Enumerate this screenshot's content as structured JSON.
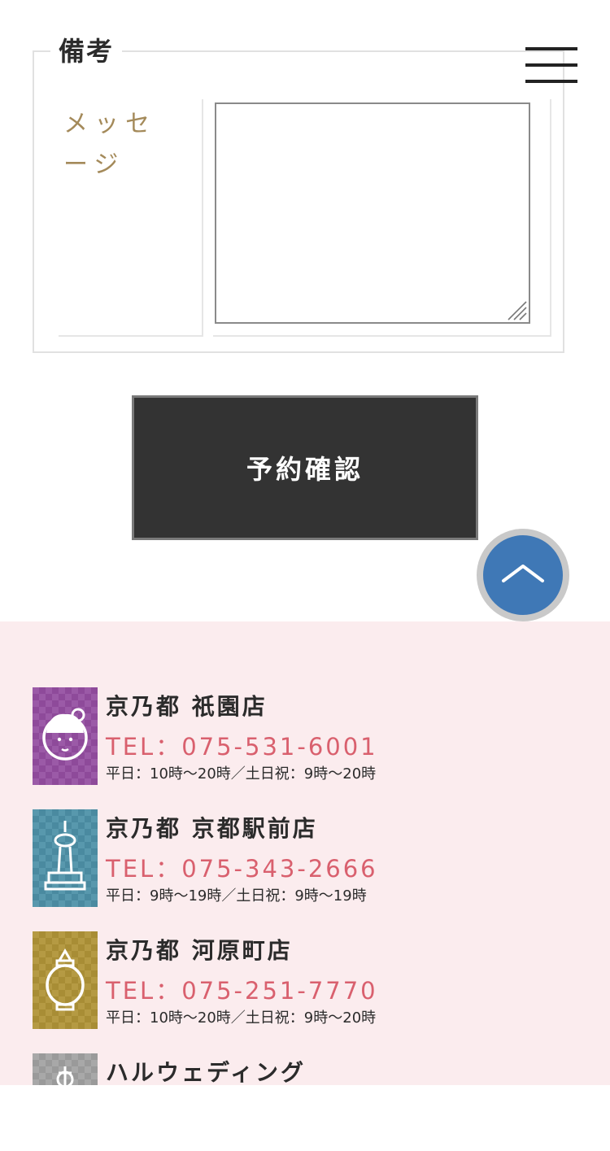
{
  "form": {
    "legend": "備考",
    "message_label": "メッセージ",
    "message_value": "",
    "submit_label": "予約確認"
  },
  "icons": {
    "menu": "hamburger-menu-icon",
    "to_top": "chevron-up-icon",
    "resize": "resize-grip-icon"
  },
  "colors": {
    "submit_bg": "#333333",
    "label_gold": "#a48a5a",
    "tel_pink": "#d9606e",
    "footer_bg": "#fbecee",
    "to_top_blue": "#3f78b6"
  },
  "stores": [
    {
      "name": "京乃都 祇園店",
      "tel": "TEL：075-531-6001",
      "hours": "平日：10時〜20時／土日祝：9時〜20時",
      "icon": "maiko-face-icon",
      "icon_color": "#8e4a9a"
    },
    {
      "name": "京乃都 京都駅前店",
      "tel": "TEL：075-343-2666",
      "hours": "平日：9時〜19時／土日祝：9時〜19時",
      "icon": "kyoto-tower-icon",
      "icon_color": "#4a8aa0"
    },
    {
      "name": "京乃都 河原町店",
      "tel": "TEL：075-251-7770",
      "hours": "平日：10時〜20時／土日祝：9時〜20時",
      "icon": "lantern-icon",
      "icon_color": "#a88d35"
    },
    {
      "name": "ハルウェディング",
      "tel": "",
      "hours": "",
      "icon": "chapel-cross-icon",
      "icon_color": "#9a9a9a"
    }
  ]
}
